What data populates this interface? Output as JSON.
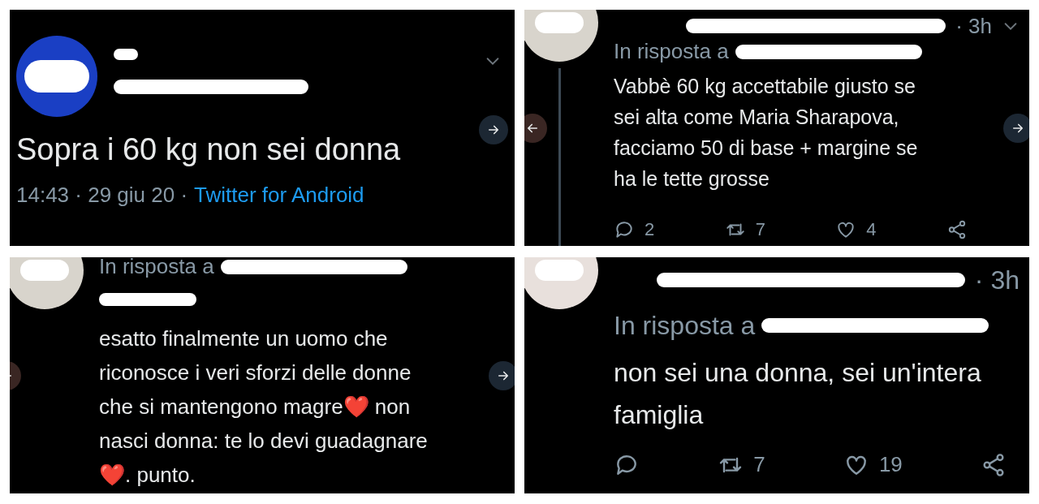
{
  "panels": [
    {
      "kind": "main",
      "text": "Sopra i 60 kg non sei donna",
      "meta": "14:43 · 29 giu 20 ·",
      "source": "Twitter for Android",
      "nav_left": false,
      "nav_right": true
    },
    {
      "kind": "reply",
      "time": "· 3h",
      "reply_prefix": "In risposta a",
      "lines": [
        "Vabbè 60 kg accettabile giusto se",
        "sei alta come Maria Sharapova,",
        "facciamo 50 di base +  margine se",
        "ha le tette grosse"
      ],
      "thread_line": true,
      "nav_left": true,
      "nav_right": true,
      "actions": [
        {
          "kind": "reply",
          "count": "2"
        },
        {
          "kind": "retweet",
          "count": "7"
        },
        {
          "kind": "like",
          "count": "4"
        },
        {
          "kind": "share"
        }
      ]
    },
    {
      "kind": "reply",
      "reply_prefix": "In risposta a",
      "lines": [
        "esatto finalmente un uomo che",
        "riconosce i veri sforzi delle donne",
        "che si mantengono magre❤️ non",
        "nasci donna: te lo devi guadagnare",
        "❤️. punto."
      ],
      "thread_line": false,
      "nav_left": true,
      "nav_right": true
    },
    {
      "kind": "reply",
      "time": "· 3h",
      "reply_prefix": "In risposta a",
      "lines": [
        "non sei una donna, sei un'intera",
        "famiglia"
      ],
      "large": true,
      "thread_line": false,
      "nav_left": false,
      "nav_right": false,
      "actions": [
        {
          "kind": "reply"
        },
        {
          "kind": "retweet",
          "count": "7"
        },
        {
          "kind": "like",
          "count": "19"
        },
        {
          "kind": "share"
        }
      ]
    }
  ]
}
